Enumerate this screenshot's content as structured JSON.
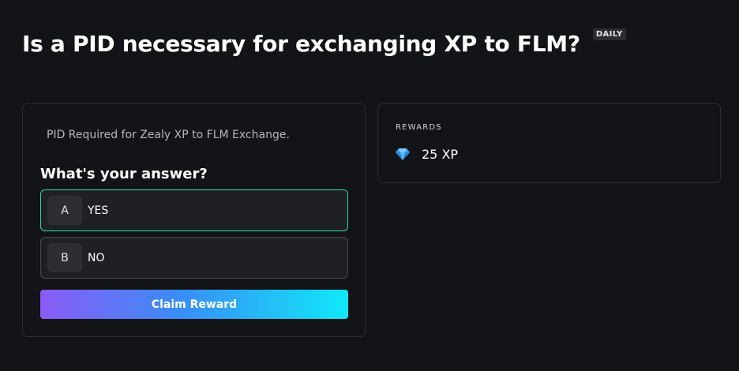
{
  "quest": {
    "title": "Is a PID necessary for exchanging XP to FLM?",
    "badge": "DAILY",
    "description": "PID Required for Zealy XP to FLM Exchange.",
    "question": "What's your answer?",
    "options": [
      {
        "key": "A",
        "label": "YES",
        "selected": true
      },
      {
        "key": "B",
        "label": "NO",
        "selected": false
      }
    ],
    "claim_label": "Claim Reward"
  },
  "rewards": {
    "heading": "REWARDS",
    "icon": "gem-icon",
    "amount": "25 XP"
  },
  "colors": {
    "background": "#131418",
    "selected_border": "#2fd8a6",
    "gradient_start": "#8a5cf6",
    "gradient_end": "#10e8f8",
    "gem": "#3aa3f0"
  }
}
